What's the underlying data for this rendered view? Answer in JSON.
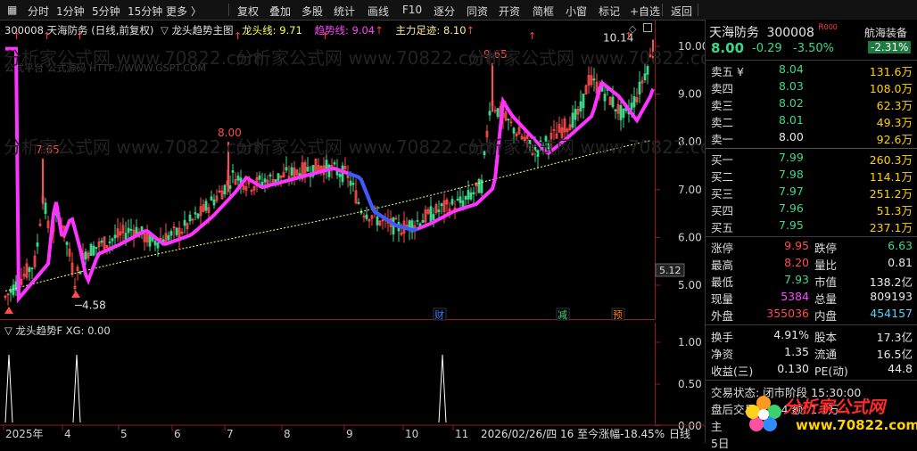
{
  "colors": {
    "up": "#ff4c4c",
    "down": "#3dd88a",
    "ma_dragon": "#ff33ff",
    "ma_dragon_down": "#3a5bff",
    "trend": "#ffff88",
    "price_sell": "#ffd200",
    "bg": "#000000"
  },
  "toolbar": {
    "items": [
      "分时",
      "1分钟",
      "5分钟",
      "15分钟",
      "更多 〉",
      "复权",
      "叠加",
      "多股",
      "统计",
      "画线",
      "F10",
      "逐分",
      "同资",
      "开资",
      "简框",
      "小窗",
      "标记",
      "+自选",
      "返回"
    ]
  },
  "chart_header": {
    "stock": "300008 天海防务 (日线,前复权)",
    "indicator_name": "龙头趋势主图",
    "dragon_label": "龙头线:",
    "dragon_value": "9.71",
    "trend_label": "趋势线:",
    "trend_value": "9.04",
    "main_label": "主力足迹:",
    "main_value": "8.10"
  },
  "watermark": {
    "text1": "公式平台 公式源码 HTTP://WWW.GSPT.COM",
    "text2": "分析家公式网 www.70822.com"
  },
  "price_axis": {
    "ticks": [
      "10.00",
      "9.00",
      "8.00",
      "7.00",
      "6.00",
      "5.00"
    ],
    "current_tag": "5.12"
  },
  "annotations": {
    "low": "4.58",
    "peak1": "7.65",
    "peak2": "8.00",
    "peak3": "9.65",
    "peak4": "10.14"
  },
  "event_markers": [
    "财",
    "减",
    "预"
  ],
  "sub_indicator": {
    "label": "龙头趋势F  XG: 0.00",
    "ticks": [
      "1.00",
      "0.50",
      "0.00"
    ]
  },
  "time_axis": {
    "labels": [
      "2025年",
      "4",
      "5",
      "6",
      "7",
      "8",
      "9",
      "10",
      "11"
    ],
    "status": "2026/02/26/四  16  至今涨幅-18.45%",
    "period": "日线"
  },
  "quote": {
    "name": "天海防务",
    "code": "300008",
    "badge": "航海装备",
    "flag": "R",
    "price": "8.00",
    "change": "-0.29",
    "pct": "-3.50%",
    "sector_pct": "-2.31%",
    "sell": [
      {
        "label": "卖五 ¥",
        "price": "8.04",
        "vol": "131.6万"
      },
      {
        "label": "卖四",
        "price": "8.03",
        "vol": "108.0万"
      },
      {
        "label": "卖三",
        "price": "8.02",
        "vol": "62.3万"
      },
      {
        "label": "卖二",
        "price": "8.01",
        "vol": "49.3万"
      },
      {
        "label": "卖一",
        "price": "8.00",
        "vol": "92.6万"
      }
    ],
    "buy": [
      {
        "label": "买一",
        "price": "7.99",
        "vol": "260.3万"
      },
      {
        "label": "买二",
        "price": "7.98",
        "vol": "114.1万"
      },
      {
        "label": "买三",
        "price": "7.97",
        "vol": "251.2万"
      },
      {
        "label": "买四",
        "price": "7.96",
        "vol": "51.3万"
      },
      {
        "label": "买五",
        "price": "7.95",
        "vol": "237.1万"
      }
    ],
    "stats1": [
      {
        "l": "涨停",
        "v": "9.95",
        "l2": "跌停",
        "v2": "6.63"
      },
      {
        "l": "最高",
        "v": "8.20",
        "l2": "量比",
        "v2": "0.81"
      },
      {
        "l": "最低",
        "v": "7.93",
        "l2": "市值",
        "v2": "138.2亿"
      },
      {
        "l": "现量",
        "v": "5384",
        "l2": "总量",
        "v2": "809193"
      },
      {
        "l": "外盘",
        "v": "355036",
        "l2": "内盘",
        "v2": "454157"
      }
    ],
    "stats2": [
      {
        "l": "换手",
        "v": "4.91%",
        "l2": "股本",
        "v2": "17.3亿"
      },
      {
        "l": "净资",
        "v": "1.35",
        "l2": "流通",
        "v2": "16.5亿"
      },
      {
        "l": "收益(三)",
        "v": "0.130",
        "l2": "PE(动)",
        "v2": "44.8"
      }
    ],
    "trade_status": "交易状态: 闭市阶段 15:30:00",
    "after_hours": "盘后交易量: 14  额: 1.1万",
    "footer_logo": "分析家公式网",
    "footer_url": "www.70822.com",
    "footer_cut1": "主",
    "footer_cut2": "5日"
  }
}
